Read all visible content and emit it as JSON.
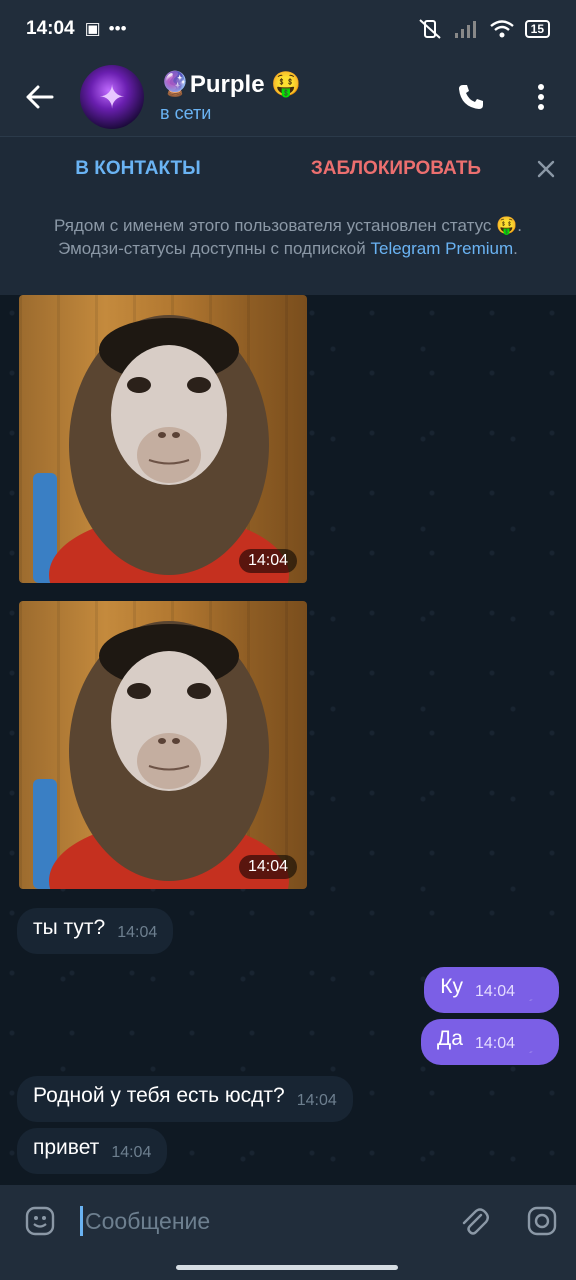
{
  "status_bar": {
    "time": "14:04",
    "battery": "15"
  },
  "header": {
    "title": "🔮Purple 🤑",
    "status": "в сети",
    "avatar_emoji": "✦"
  },
  "actions": {
    "add_contact": "В КОНТАКТЫ",
    "block": "ЗАБЛОКИРОВАТЬ"
  },
  "notice": {
    "text": "Рядом с именем этого пользователя установлен статус 🤑. Эмодзи-статусы доступны с подпиской",
    "link": "Telegram Premium",
    "tail": "."
  },
  "messages": [
    {
      "type": "photo",
      "time": "14:04"
    },
    {
      "type": "photo",
      "time": "14:04"
    },
    {
      "type": "text",
      "dir": "in",
      "text": "ты тут?",
      "time": "14:04"
    },
    {
      "type": "text",
      "dir": "out",
      "text": "Ку",
      "time": "14:04",
      "read": true
    },
    {
      "type": "text",
      "dir": "out",
      "text": "Да",
      "time": "14:04",
      "read": true
    },
    {
      "type": "text",
      "dir": "in",
      "text": "Родной у тебя есть юсдт?",
      "time": "14:04"
    },
    {
      "type": "text",
      "dir": "in",
      "text": "привет",
      "time": "14:04"
    }
  ],
  "composer": {
    "placeholder": "Сообщение"
  },
  "colors": {
    "accent": "#6ab3f3",
    "danger": "#ec6f6f",
    "outgoing_bubble": "#7b5fe6",
    "incoming_bubble": "#182533",
    "header_bg": "#212d3b"
  }
}
